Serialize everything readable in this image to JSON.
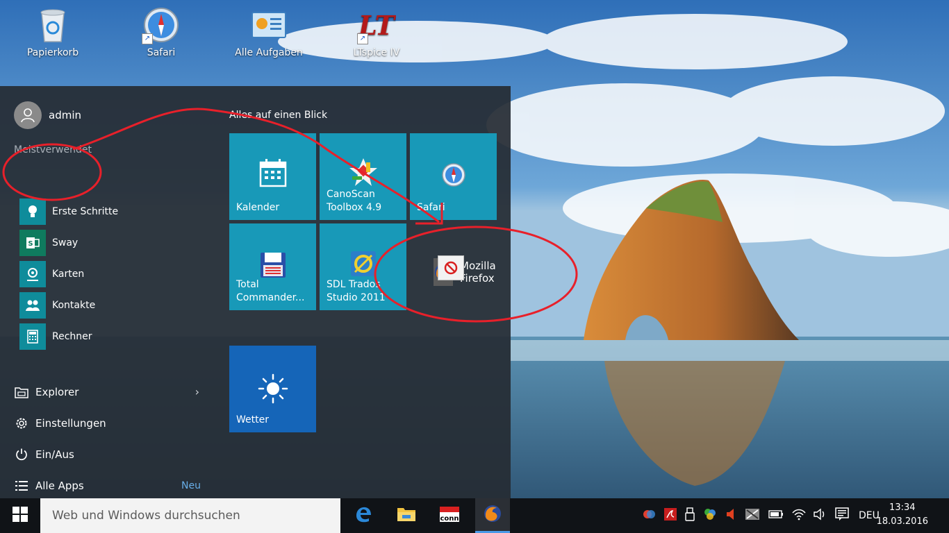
{
  "desktop": {
    "icons": [
      {
        "label": "Papierkorb",
        "icon": "recycle-bin-icon"
      },
      {
        "label": "Safari",
        "icon": "safari-compass-icon"
      },
      {
        "label": "Alle Aufgaben",
        "icon": "control-panel-icon"
      },
      {
        "label": "LTspice IV",
        "icon": "ltspice-icon"
      }
    ]
  },
  "start_menu": {
    "user": {
      "name": "admin",
      "icon": "user-avatar-icon"
    },
    "most_used_label": "Meistverwendet",
    "apps": [
      {
        "label": "Erste Schritte",
        "icon": "lightbulb-icon"
      },
      {
        "label": "Sway",
        "icon": "sway-icon"
      },
      {
        "label": "Karten",
        "icon": "maps-icon"
      },
      {
        "label": "Kontakte",
        "icon": "contacts-icon"
      },
      {
        "label": "Rechner",
        "icon": "calculator-icon"
      }
    ],
    "bottom": {
      "explorer": "Explorer",
      "settings": "Einstellungen",
      "power": "Ein/Aus",
      "all_apps": "Alle Apps",
      "new_badge": "Neu"
    },
    "group_title": "Alles auf einen Blick",
    "tiles": [
      {
        "label_line1": "Kalender",
        "label_line2": "",
        "icon": "calendar-icon"
      },
      {
        "label_line1": "CanoScan",
        "label_line2": "Toolbox 4.9",
        "icon": "canoscan-icon"
      },
      {
        "label_line1": "Safari",
        "label_line2": "",
        "icon": "safari-compass-icon"
      },
      {
        "label_line1": "Total",
        "label_line2": "Commander...",
        "icon": "floppy-icon"
      },
      {
        "label_line1": "SDL Trados",
        "label_line2": "Studio 2011",
        "icon": "trados-icon"
      },
      {
        "label_line1": "Wetter",
        "label_line2": "",
        "icon": "sun-icon"
      }
    ],
    "drag_item": {
      "label": "Mozilla Firefox",
      "icon": "firefox-icon",
      "cursor": "no-drop-icon"
    }
  },
  "taskbar": {
    "search_placeholder": "Web und Windows durchsuchen",
    "apps": [
      {
        "name": "Edge",
        "icon": "edge-icon"
      },
      {
        "name": "Explorer",
        "icon": "folder-icon"
      },
      {
        "name": "Conrad",
        "icon": "conrad-icon"
      },
      {
        "name": "Firefox",
        "icon": "firefox-icon"
      }
    ],
    "language": "DEU",
    "time": "13:34",
    "date": "18.03.2016"
  },
  "colors": {
    "tile": "#1899b8",
    "weather_tile": "#1565b8",
    "annotation": "#e8202a",
    "start_bg": "#262c34"
  }
}
